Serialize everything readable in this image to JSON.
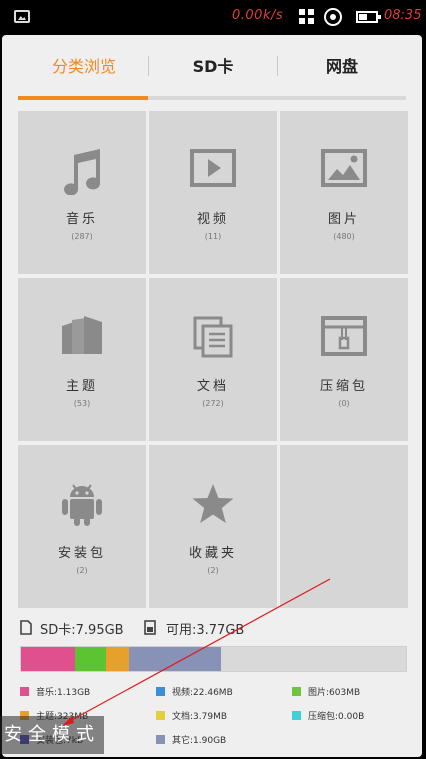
{
  "status_bar": {
    "network_speed": "0.00k/s",
    "time": "08:35"
  },
  "tabs": [
    {
      "label": "分类浏览",
      "active": true
    },
    {
      "label": "SD卡",
      "active": false
    },
    {
      "label": "网盘",
      "active": false
    }
  ],
  "categories": [
    {
      "label": "音乐",
      "count": "(287)",
      "icon": "music-note-icon"
    },
    {
      "label": "视频",
      "count": "(11)",
      "icon": "video-play-icon"
    },
    {
      "label": "图片",
      "count": "(480)",
      "icon": "picture-icon"
    },
    {
      "label": "主题",
      "count": "(53)",
      "icon": "theme-icon"
    },
    {
      "label": "文档",
      "count": "(272)",
      "icon": "document-icon"
    },
    {
      "label": "压缩包",
      "count": "(0)",
      "icon": "zip-archive-icon"
    },
    {
      "label": "安装包",
      "count": "(2)",
      "icon": "android-icon"
    },
    {
      "label": "收藏夹",
      "count": "(2)",
      "icon": "star-icon"
    }
  ],
  "storage": {
    "sd_total": "SD卡:7.95GB",
    "available": "可用:3.77GB",
    "usage_fractions": [
      {
        "name": "音乐",
        "fraction": 0.14,
        "color": "#e0508f"
      },
      {
        "name": "主题",
        "fraction": 0.08,
        "color": "#5cc332"
      },
      {
        "name": "文档",
        "fraction": 0.06,
        "color": "#e8a02c"
      },
      {
        "name": "其它",
        "fraction": 0.24,
        "color": "#8792b6"
      }
    ]
  },
  "legend": [
    {
      "label": "音乐:1.13GB",
      "color": "#e0508f"
    },
    {
      "label": "视频:22.46MB",
      "color": "#3b8fd6"
    },
    {
      "label": "图片:603MB",
      "color": "#6ec43c"
    },
    {
      "label": "主题:323MB",
      "color": "#e8a02c"
    },
    {
      "label": "文档:3.79MB",
      "color": "#e2cf3a"
    },
    {
      "label": "压缩包:0.00B",
      "color": "#3fd1d6"
    },
    {
      "label": "安装包:7kB",
      "color": "#5a4fc4"
    },
    {
      "label": "其它:1.90GB",
      "color": "#8792b6"
    }
  ],
  "overlay": {
    "safe_mode_label": "安全模式"
  }
}
